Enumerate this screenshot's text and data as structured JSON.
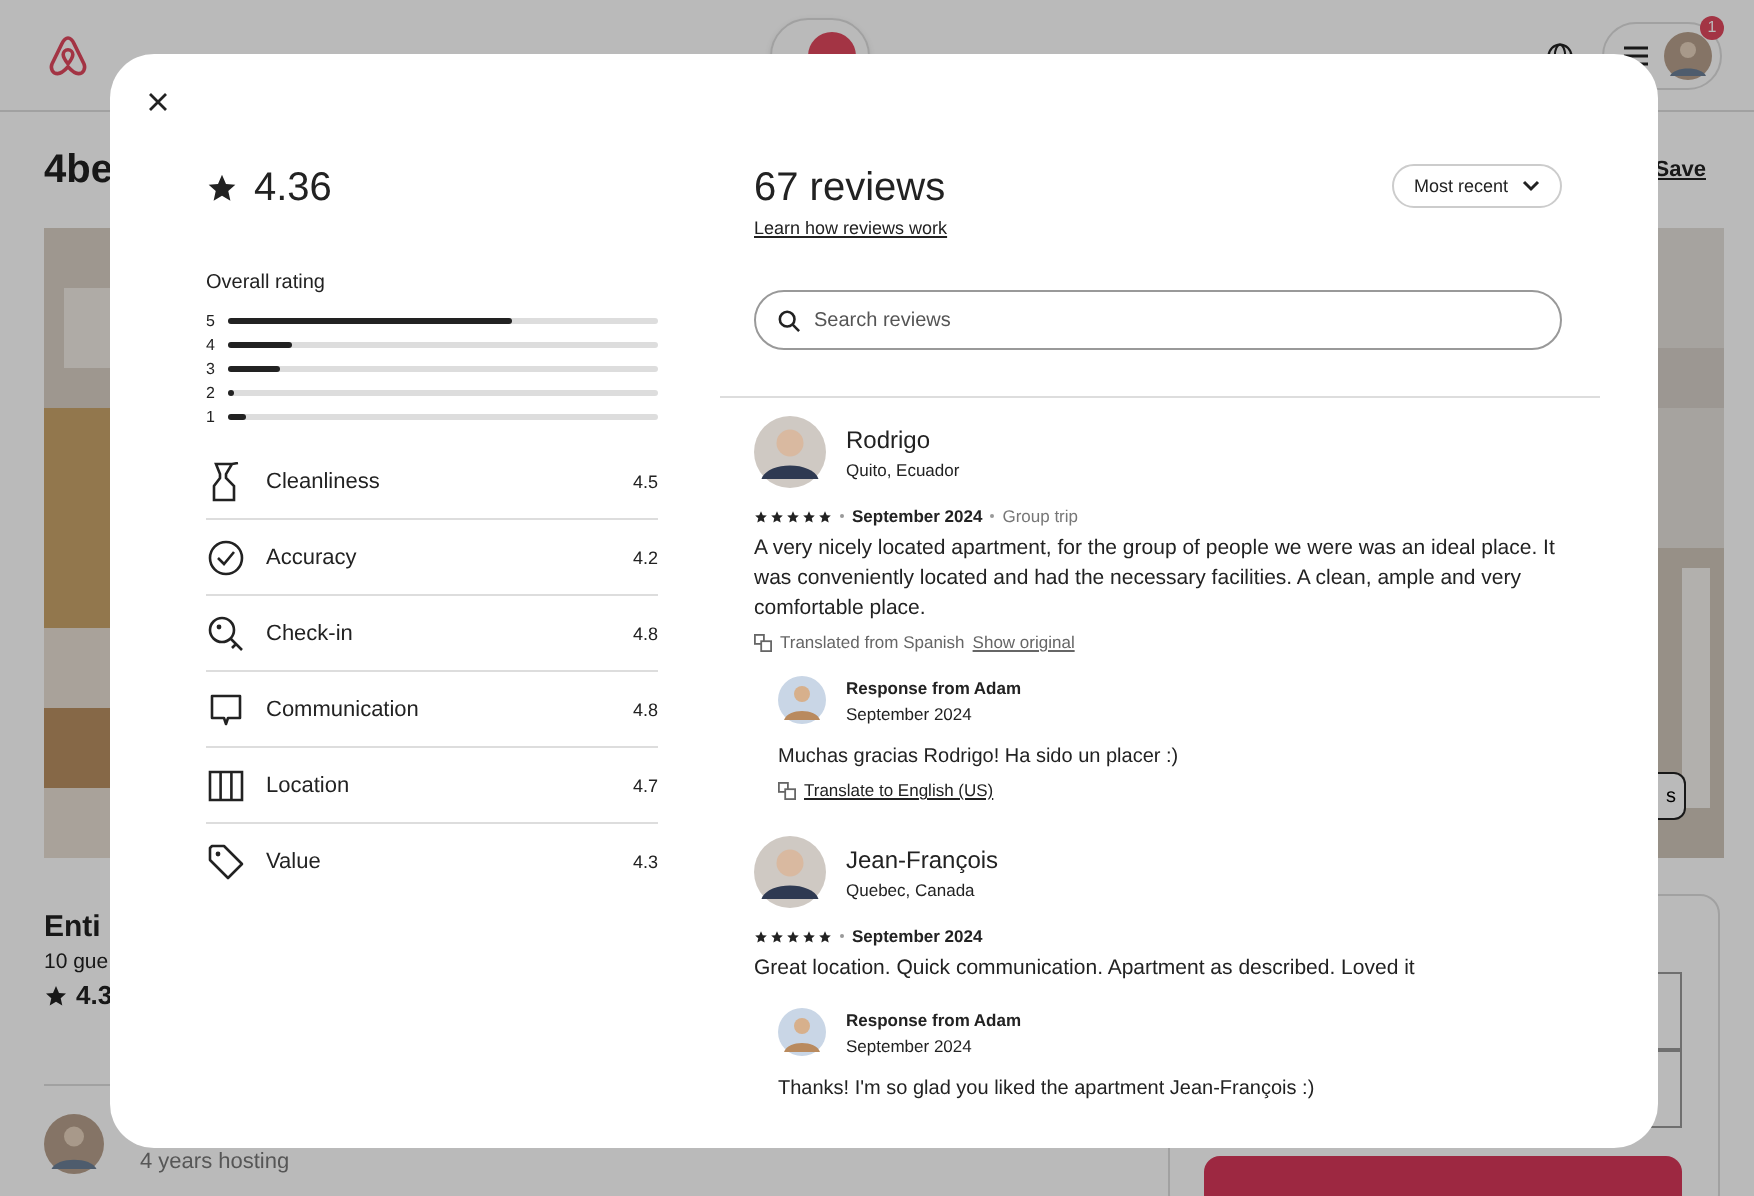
{
  "header": {
    "notification_count": "1"
  },
  "listing": {
    "title": "4be",
    "save": "Save",
    "side_button": "s",
    "summary_title": "Enti",
    "guests": "10 gue",
    "rating": "4.3",
    "host_meta": "4 years hosting"
  },
  "modal": {
    "rating": "4.36",
    "overall_label": "Overall rating",
    "distribution": [
      {
        "label": "5",
        "level": 0.66
      },
      {
        "label": "4",
        "level": 0.15
      },
      {
        "label": "3",
        "level": 0.12
      },
      {
        "label": "2",
        "level": 0.01
      },
      {
        "label": "1",
        "level": 0.04
      }
    ],
    "categories": [
      {
        "kind": "spray",
        "label": "Cleanliness",
        "score": "4.5"
      },
      {
        "kind": "check",
        "label": "Accuracy",
        "score": "4.2"
      },
      {
        "kind": "key",
        "label": "Check-in",
        "score": "4.8"
      },
      {
        "kind": "chat",
        "label": "Communication",
        "score": "4.8"
      },
      {
        "kind": "map",
        "label": "Location",
        "score": "4.7"
      },
      {
        "kind": "tag",
        "label": "Value",
        "score": "4.3"
      }
    ],
    "review_count": "67 reviews",
    "learn_link": "Learn how reviews work",
    "sort": "Most recent",
    "search_placeholder": "Search reviews",
    "reviews": [
      {
        "name": "Rodrigo",
        "location": "Quito, Ecuador",
        "stars": 5,
        "date": "September 2024",
        "trip_type": "Group trip",
        "text": "A very nicely located apartment, for the group of people we were was an ideal place. It was conveniently located and had the necessary facilities. A clean, ample and very comfortable place.",
        "translation": {
          "note": "Translated from Spanish",
          "link": "Show original"
        },
        "response": {
          "author": "Response from Adam",
          "date": "September 2024",
          "text": "Muchas gracias Rodrigo! Ha sido un placer :)",
          "translate_link": "Translate to English (US)"
        }
      },
      {
        "name": "Jean-François",
        "location": "Quebec, Canada",
        "stars": 5,
        "date": "September 2024",
        "text": "Great location. Quick communication. Apartment as described. Loved it",
        "response": {
          "author": "Response from Adam",
          "date": "September 2024",
          "text": "Thanks! I'm so glad you liked the apartment Jean-François :)"
        }
      }
    ]
  }
}
